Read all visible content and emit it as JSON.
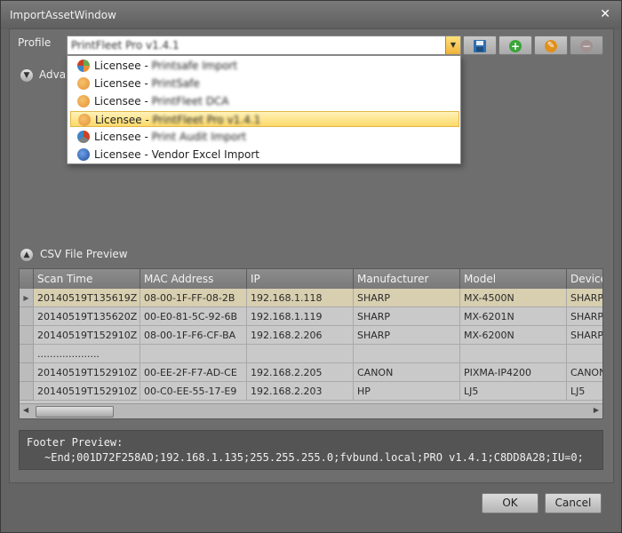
{
  "window": {
    "title": "ImportAssetWindow"
  },
  "profile": {
    "label": "Profile",
    "selected": "PrintFleet Pro v1.4.1",
    "options": [
      {
        "prefix": "Licensee - ",
        "name": "Printsafe Import",
        "blurred": true,
        "icon_color": "#6aa84f"
      },
      {
        "prefix": "Licensee - ",
        "name": "PrintSafe",
        "blurred": true,
        "icon_color": "#e69138"
      },
      {
        "prefix": "Licensee - ",
        "name": "PrintFleet DCA",
        "blurred": true,
        "icon_color": "#e69138"
      },
      {
        "prefix": "Licensee - ",
        "name": "PrintFleet Pro v1.4.1",
        "blurred": true,
        "icon_color": "#e69138",
        "selected": true
      },
      {
        "prefix": "Licensee - ",
        "name": "Print Audit Import",
        "blurred": true,
        "icon_color": "#cc4125"
      },
      {
        "prefix": "Licensee - ",
        "name": "Vendor Excel Import",
        "blurred": false,
        "icon_color": "#3d6fc4"
      }
    ]
  },
  "toolbar": {
    "save_icon": "floppy-disk-icon",
    "add_icon": "plus-icon",
    "edit_icon": "pencil-icon",
    "remove_icon": "minus-icon"
  },
  "advanced": {
    "label": "Advan"
  },
  "csv_preview": {
    "label": "CSV File Preview",
    "columns": [
      "Scan Time",
      "MAC Address",
      "IP",
      "Manufacturer",
      "Model",
      "Device"
    ],
    "rows": [
      [
        "20140519T135619Z",
        "08-00-1F-FF-08-2B",
        "192.168.1.118",
        "SHARP",
        "MX-4500N",
        "SHARP"
      ],
      [
        "20140519T135620Z",
        "00-E0-81-5C-92-6B",
        "192.168.1.119",
        "SHARP",
        "MX-6201N",
        "SHARP"
      ],
      [
        "20140519T152910Z",
        "08-00-1F-F6-CF-BA",
        "192.168.2.206",
        "SHARP",
        "MX-6200N",
        "SHARP"
      ],
      [
        "....................",
        "",
        "",
        "",
        "",
        ""
      ],
      [
        "20140519T152910Z",
        "00-EE-2F-F7-AD-CE",
        "192.168.2.205",
        "CANON",
        "PIXMA-IP4200",
        "CANON"
      ],
      [
        "20140519T152910Z",
        "00-C0-EE-55-17-E9",
        "192.168.2.203",
        "HP",
        "LJ5",
        "LJ5"
      ]
    ]
  },
  "footer_preview": {
    "label": "Footer Preview:",
    "value": "~End;001D72F258AD;192.168.1.135;255.255.255.0;fvbund.local;PRO v1.4.1;C8DD8A28;IU=0;"
  },
  "buttons": {
    "ok": "OK",
    "cancel": "Cancel"
  }
}
